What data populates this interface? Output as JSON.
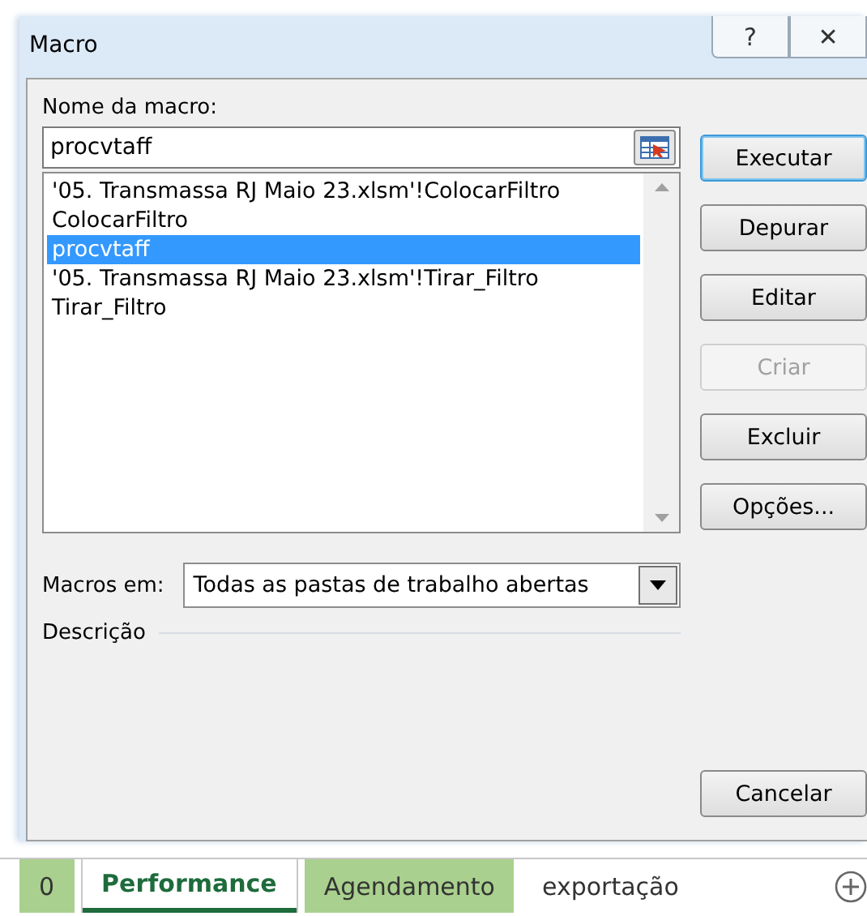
{
  "window": {
    "title": "Macro",
    "title_buttons": [
      "?",
      "✕"
    ]
  },
  "name_field": {
    "label": "Nome da macro:",
    "value": "procvtaff"
  },
  "macros": [
    {
      "label": "'05. Transmassa RJ Maio 23.xlsm'!ColocarFiltro",
      "selected": false
    },
    {
      "label": "ColocarFiltro",
      "selected": false
    },
    {
      "label": "procvtaff",
      "selected": true
    },
    {
      "label": "'05. Transmassa RJ Maio 23.xlsm'!Tirar_Filtro",
      "selected": false
    },
    {
      "label": "Tirar_Filtro",
      "selected": false
    }
  ],
  "buttons": [
    {
      "label": "Executar",
      "disabled": false,
      "focused": true
    },
    {
      "label": "Depurar",
      "disabled": false,
      "focused": false
    },
    {
      "label": "Editar",
      "disabled": false,
      "focused": false
    },
    {
      "label": "Criar",
      "disabled": true,
      "focused": false
    },
    {
      "label": "Excluir",
      "disabled": false,
      "focused": false
    },
    {
      "label": "Opções...",
      "disabled": false,
      "focused": false
    }
  ],
  "macros_in": {
    "label": "Macros em:",
    "value": "Todas as pastas de trabalho abertas"
  },
  "description": {
    "label": "Descrição"
  },
  "cancel_button": {
    "label": "Cancelar"
  },
  "sheet_tabs": [
    {
      "label": "0",
      "selected": false,
      "color": "#a9d08e"
    },
    {
      "label": "Performance",
      "selected": true
    },
    {
      "label": "Agendamento",
      "selected": false,
      "color": "#a9d08e"
    },
    {
      "label": "exportação",
      "selected": false
    }
  ]
}
